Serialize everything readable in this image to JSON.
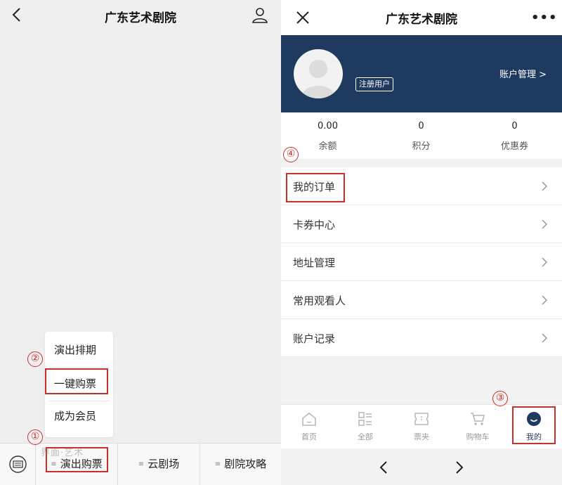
{
  "left": {
    "title": "广东艺术剧院",
    "popup_items": [
      "演出排期",
      "一键购票",
      "成为会员"
    ],
    "tabs": [
      "演出购票",
      "云剧场",
      "剧院攻略"
    ],
    "watermark": "界面·艺术"
  },
  "right": {
    "title": "广东艺术剧院",
    "more": "•••",
    "badge": "注册用户",
    "account_link": "账户管理 >",
    "stats": [
      {
        "value": "0.00",
        "label": "余额"
      },
      {
        "value": "0",
        "label": "积分"
      },
      {
        "value": "0",
        "label": "优惠券"
      }
    ],
    "menu": [
      "我的订单",
      "卡券中心",
      "地址管理",
      "常用观看人",
      "账户记录"
    ],
    "nav": [
      "首页",
      "全部",
      "票夹",
      "购物车",
      "我的"
    ]
  },
  "annotations": [
    "①",
    "②",
    "③",
    "④"
  ],
  "colors": {
    "brand": "#1f3a5f",
    "highlight": "#c9302c",
    "page_bg": "#efefef"
  }
}
